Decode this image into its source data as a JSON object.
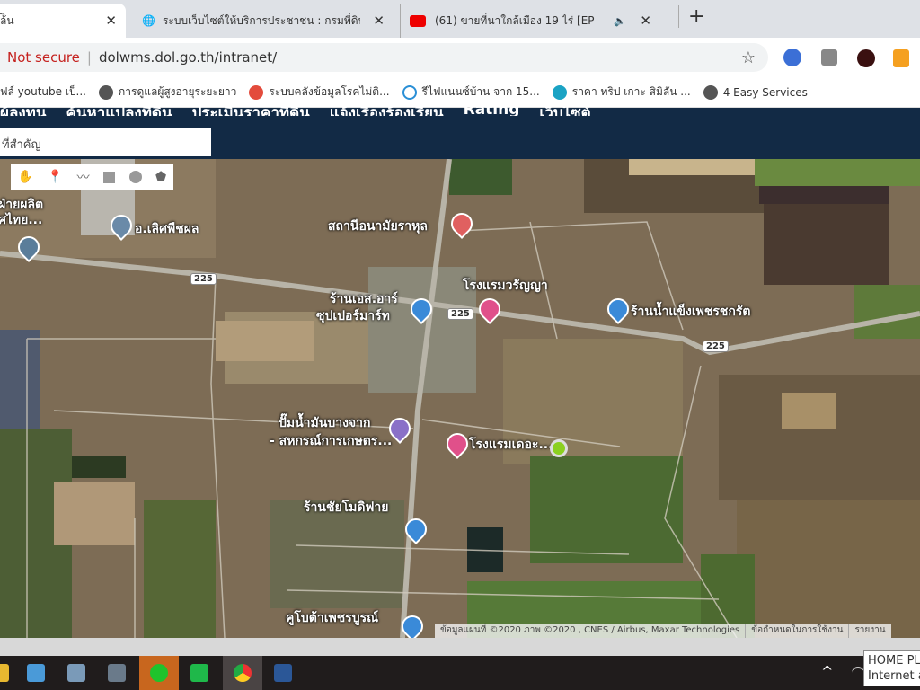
{
  "tabs": [
    {
      "title": "ล้ิน",
      "active": true
    },
    {
      "title": "ระบบเว็บไซต์ให้บริการประชาชน : กรมที่ดิน",
      "icon": "globe-icon"
    },
    {
      "title": "(61) ขายที่นาใกล้เมือง 19 ไร่ [EP",
      "icon": "youtube-icon"
    }
  ],
  "address": {
    "security": "Not secure",
    "url": "dolwms.dol.go.th/intranet/"
  },
  "bookmarks": [
    {
      "label": "ฟล์ youtube เป็...",
      "color": "#ffffff"
    },
    {
      "label": "การดูแลผู้สูงอายุระยะยาว",
      "color": "#555555"
    },
    {
      "label": "ระบบคลังข้อมูลโรคไม่ติ...",
      "color": "#e34b3c"
    },
    {
      "label": "รีไฟแนนซ์บ้าน จาก 15...",
      "color": "#2a8fd6"
    },
    {
      "label": "ราคา ทริป เกาะ สิมิลัน ...",
      "color": "#1ba3c4"
    },
    {
      "label": "4 Easy Services",
      "color": "#555555"
    }
  ],
  "site_nav": {
    "items": [
      "ผู้ลงทุน",
      "ค้นหาแปลงที่ดิน",
      "ประเมินราคาที่ดิน",
      "แจ้งเรื่องร้องเรียน",
      "Rating",
      "เว็บไซต์"
    ],
    "search_placeholder": "ที่สำคัญ"
  },
  "map": {
    "labels": {
      "factory": "ฝ่ายผลิต\nศไทย...",
      "lertpuechpon": "อ.เลิศพืชผล",
      "health": "สถานีอนามัยราหุล",
      "hotel1": "โรงแรมวรัญญา",
      "sr_line1": "ร้านเอส.อาร์",
      "sr_line2": "ซุปเปอร์มาร์ท",
      "ice": "ร้านน้ำแข็งเพชรชกรัต",
      "gas_line1": "ปั๊มน้ำมันบางจาก",
      "gas_line2": "- สหกรณ์การเกษตร...",
      "hotel2": "โรงแรมเดอะ...",
      "chai": "ร้านชัยโมดิฟาย",
      "kubota": "คูโบต้าเพชรบูรณ์"
    },
    "road_number": "225",
    "attribution": "ข้อมูลแผนที่ ©2020 ภาพ ©2020 , CNES / Airbus, Maxar Technologies",
    "terms": "ข้อกำหนดในการใช้งาน",
    "report": "รายงาน",
    "tools": [
      "hand-icon",
      "marker-icon",
      "polyline-icon",
      "rectangle-icon",
      "circle-icon",
      "polygon-icon"
    ]
  },
  "tooltip": {
    "line1": "HOME PL",
    "line2": "Internet a"
  }
}
